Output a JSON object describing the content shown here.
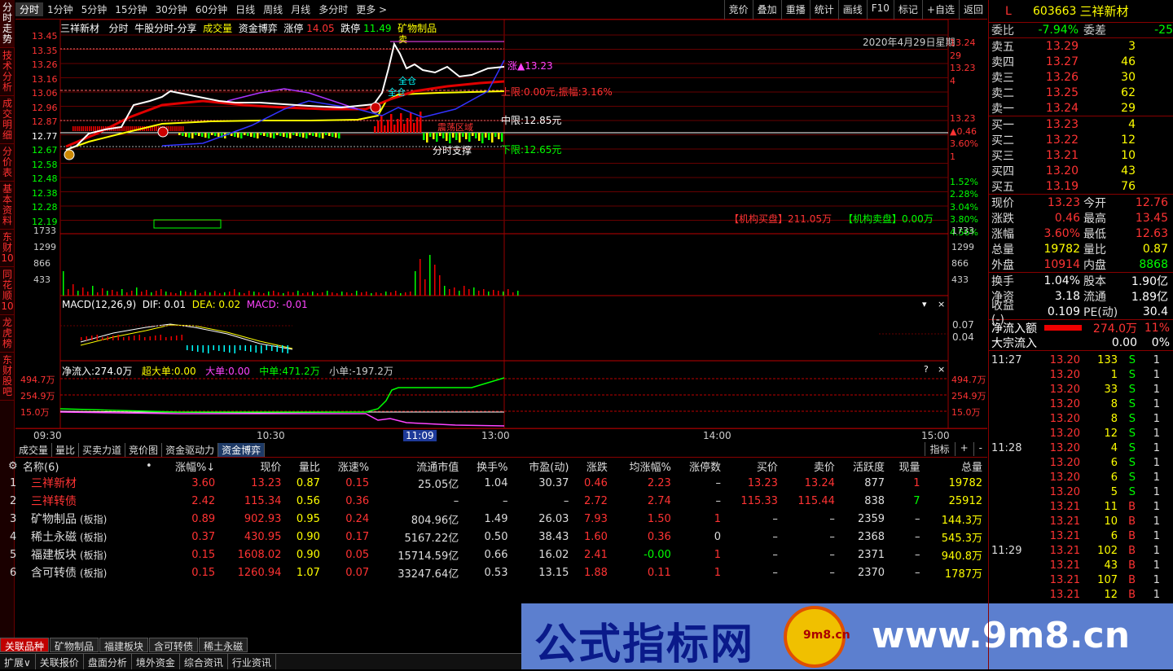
{
  "left_tabs": [
    "分时走势",
    "技术分析",
    "成交明细",
    "分价表",
    "基本资料",
    "东财10",
    "同花顺10",
    "龙虎榜",
    "东财股吧"
  ],
  "top_tabs": [
    "分时",
    "1分钟",
    "5分钟",
    "15分钟",
    "30分钟",
    "60分钟",
    "日线",
    "周线",
    "月线",
    "多分时",
    "更多 >"
  ],
  "top_tools": [
    "竞价",
    "叠加",
    "重播",
    "统计",
    "画线",
    "F10",
    "标记",
    "+自选",
    "返回"
  ],
  "chart_header": {
    "name": "三祥新材",
    "mode": "分时",
    "indicator": "牛股分时-分享",
    "vol": "成交量",
    "fund": "资金博弈",
    "up_label": "涨停",
    "up_val": "14.05",
    "down_label": "跌停",
    "down_val": "11.49",
    "sector": "矿物制品",
    "date": "2020年4月29日星期"
  },
  "y_left": [
    "13.45",
    "13.35",
    "13.26",
    "13.16",
    "13.06",
    "12.96",
    "12.87",
    "12.77",
    "12.67",
    "12.58",
    "12.48",
    "12.38",
    "12.28",
    "12.19"
  ],
  "y_right": [
    "13.24",
    "29",
    "13.23",
    "4",
    "",
    "",
    "13.23",
    "▲0.46",
    "3.60%",
    "1",
    "",
    "1.52%",
    "2.28%",
    "3.04%",
    "3.80%",
    "4.56%"
  ],
  "vol_left": [
    "1733",
    "1299",
    "866",
    "433"
  ],
  "vol_right": [
    "1733",
    "1299",
    "866",
    "433"
  ],
  "annotations": {
    "sell": "卖",
    "full1": "全仓",
    "full2": "全仓",
    "buy": "买",
    "rise": "涨▲13.23",
    "upper": "上限:0.00元,振幅:3.16%",
    "mid": "中限:12.85元",
    "lower": "下限:12.65元",
    "support": "分时支撑",
    "org_buy": "【机构买盘】211.05万",
    "org_sell": "【机构卖盘】0.00万",
    "chop": "震荡区域"
  },
  "macd": {
    "label": "MACD(12,26,9)",
    "dif": "DIF: 0.01",
    "dea": "DEA: 0.02",
    "macd": "MACD: -0.01",
    "r1": "0.07",
    "r2": "0.04"
  },
  "flow": {
    "net": "净流入:274.0万",
    "super": "超大单:0.00",
    "big": "大单:0.00",
    "mid": "中单:471.2万",
    "small": "小单:-197.2万",
    "yl": [
      "494.7万",
      "254.9万",
      "15.0万"
    ],
    "yr": [
      "494.7万",
      "254.9万",
      "15.0万"
    ]
  },
  "time_axis": [
    "09:30",
    "10:30",
    "11:09",
    "13:00",
    "14:00",
    "15:00"
  ],
  "bottom_tabs": [
    "成交量",
    "量比",
    "买卖力道",
    "竞价图",
    "资金驱动力",
    "资金博弈"
  ],
  "bottom_right": [
    "指标",
    "+",
    "-"
  ],
  "table_headers": [
    "名称(6)",
    "•",
    "涨幅%↓",
    "现价",
    "量比",
    "涨速%",
    "流通市值",
    "换手%",
    "市盈(动)",
    "涨跌",
    "均涨幅%",
    "涨停数",
    "买价",
    "卖价",
    "活跃度",
    "现量",
    "总量"
  ],
  "table_rows": [
    [
      "1",
      "三祥新材",
      "",
      "3.60",
      "13.23",
      "0.87",
      "0.15",
      "25.05亿",
      "1.04",
      "30.37",
      "0.46",
      "2.23",
      "–",
      "13.23",
      "13.24",
      "877",
      "1",
      "19782"
    ],
    [
      "2",
      "三祥转债",
      "",
      "2.42",
      "115.34",
      "0.56",
      "0.36",
      "–",
      "–",
      "–",
      "2.72",
      "2.74",
      "–",
      "115.33",
      "115.44",
      "838",
      "7",
      "25912"
    ],
    [
      "3",
      "矿物制品",
      "(板指)",
      "0.89",
      "902.93",
      "0.95",
      "0.24",
      "804.96亿",
      "1.49",
      "26.03",
      "7.93",
      "1.50",
      "1",
      "–",
      "–",
      "2359",
      "–",
      "144.3万"
    ],
    [
      "4",
      "稀土永磁",
      "(板指)",
      "0.37",
      "430.95",
      "0.90",
      "0.17",
      "5167.22亿",
      "0.50",
      "38.43",
      "1.60",
      "0.36",
      "0",
      "–",
      "–",
      "2368",
      "–",
      "545.3万"
    ],
    [
      "5",
      "福建板块",
      "(板指)",
      "0.15",
      "1608.02",
      "0.90",
      "0.05",
      "15714.59亿",
      "0.66",
      "16.02",
      "2.41",
      "-0.00",
      "1",
      "–",
      "–",
      "2371",
      "–",
      "940.8万"
    ],
    [
      "6",
      "含可转债",
      "(板指)",
      "0.15",
      "1260.94",
      "1.07",
      "0.07",
      "33247.64亿",
      "0.53",
      "13.15",
      "1.88",
      "0.11",
      "1",
      "–",
      "–",
      "2370",
      "–",
      "1787万"
    ]
  ],
  "sector_tabs": [
    "关联品种",
    "矿物制品",
    "福建板块",
    "含可转债",
    "稀土永磁"
  ],
  "status_tabs": [
    "扩展∨",
    "关联报价",
    "盘面分析",
    "境外资金",
    "综合资讯",
    "行业资讯"
  ],
  "banner": {
    "title": "公式指标网",
    "url": "www.9m8.cn",
    "logo": "9m8.cn"
  },
  "quote": {
    "code": "603663",
    "name": "三祥新材",
    "flag": "L",
    "ratio_label": "委比",
    "ratio": "-7.94%",
    "diff_label": "委差",
    "diff": "-25",
    "sells": [
      [
        "卖五",
        "13.29",
        "3"
      ],
      [
        "卖四",
        "13.27",
        "46"
      ],
      [
        "卖三",
        "13.26",
        "30"
      ],
      [
        "卖二",
        "13.25",
        "62"
      ],
      [
        "卖一",
        "13.24",
        "29"
      ]
    ],
    "buys": [
      [
        "买一",
        "13.23",
        "4"
      ],
      [
        "买二",
        "13.22",
        "12"
      ],
      [
        "买三",
        "13.21",
        "10"
      ],
      [
        "买四",
        "13.20",
        "43"
      ],
      [
        "买五",
        "13.19",
        "76"
      ]
    ],
    "stats": [
      [
        "现价",
        "13.23",
        "今开",
        "12.76"
      ],
      [
        "涨跌",
        "0.46",
        "最高",
        "13.45"
      ],
      [
        "涨幅",
        "3.60%",
        "最低",
        "12.63"
      ],
      [
        "总量",
        "19782",
        "量比",
        "0.87"
      ],
      [
        "外盘",
        "10914",
        "内盘",
        "8868"
      ]
    ],
    "stats2": [
      [
        "换手",
        "1.04%",
        "股本",
        "1.90亿"
      ],
      [
        "净资",
        "3.18",
        "流通",
        "1.89亿"
      ],
      [
        "收益(-)",
        "0.109",
        "PE(动)",
        "30.4"
      ]
    ],
    "net_flow_label": "净流入额",
    "net_flow": "274.0万",
    "net_flow_pct": "11%",
    "block_label": "大宗流入",
    "block": "0.00",
    "block_pct": "0%"
  },
  "ticks": [
    [
      "11:27",
      "13.20",
      "133",
      "S"
    ],
    [
      "",
      "13.20",
      "1",
      "S"
    ],
    [
      "",
      "13.20",
      "33",
      "S"
    ],
    [
      "",
      "13.20",
      "8",
      "S"
    ],
    [
      "",
      "13.20",
      "8",
      "S"
    ],
    [
      "",
      "13.20",
      "12",
      "S"
    ],
    [
      "11:28",
      "13.20",
      "4",
      "S"
    ],
    [
      "",
      "13.20",
      "6",
      "S"
    ],
    [
      "",
      "13.20",
      "6",
      "S"
    ],
    [
      "",
      "13.20",
      "5",
      "S"
    ],
    [
      "",
      "13.21",
      "11",
      "B"
    ],
    [
      "",
      "13.21",
      "10",
      "B"
    ],
    [
      "",
      "13.21",
      "6",
      "B"
    ],
    [
      "11:29",
      "13.21",
      "102",
      "B"
    ],
    [
      "",
      "13.21",
      "43",
      "B"
    ],
    [
      "",
      "13.21",
      "107",
      "B"
    ],
    [
      "",
      "13.21",
      "12",
      "B"
    ]
  ],
  "tick_side": [
    "1",
    "1",
    "1",
    "1",
    "1",
    "1",
    "1",
    "1",
    "1",
    "1",
    "1",
    "1",
    "1",
    "1",
    "1",
    "1",
    "1"
  ]
}
